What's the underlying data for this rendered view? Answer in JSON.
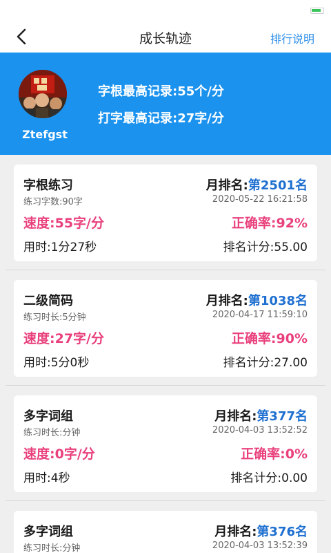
{
  "nav": {
    "title": "成长轨迹",
    "right_link": "排行说明"
  },
  "profile": {
    "username": "Ztefgst",
    "root_record": "字根最高记录:55个/分",
    "typing_record": "打字最高记录:27字/分"
  },
  "labels": {
    "month_rank": "月排名:"
  },
  "colors": {
    "accent": "#1b92ee",
    "rank": "#1e6fd0",
    "highlight": "#e9407c",
    "link": "#2f8fe9"
  },
  "records": [
    {
      "title": "字根练习",
      "rank_value": "第2501名",
      "sub": "练习字数:90字",
      "date": "2020-05-22 16:21:58",
      "speed": "速度:55字/分",
      "accuracy": "正确率:92%",
      "time_used": "用时:1分27秒",
      "score": "排名计分:55.00"
    },
    {
      "title": "二级简码",
      "rank_value": "第1038名",
      "sub": "练习时长:5分钟",
      "date": "2020-04-17 11:59:10",
      "speed": "速度:27字/分",
      "accuracy": "正确率:90%",
      "time_used": "用时:5分0秒",
      "score": "排名计分:27.00"
    },
    {
      "title": "多字词组",
      "rank_value": "第377名",
      "sub": "练习时长:分钟",
      "date": "2020-04-03 13:52:52",
      "speed": "速度:0字/分",
      "accuracy": "正确率:0%",
      "time_used": "用时:4秒",
      "score": "排名计分:0.00"
    },
    {
      "title": "多字词组",
      "rank_value": "第376名",
      "sub": "练习时长:分钟",
      "date": "2020-04-03 13:52:39"
    }
  ]
}
